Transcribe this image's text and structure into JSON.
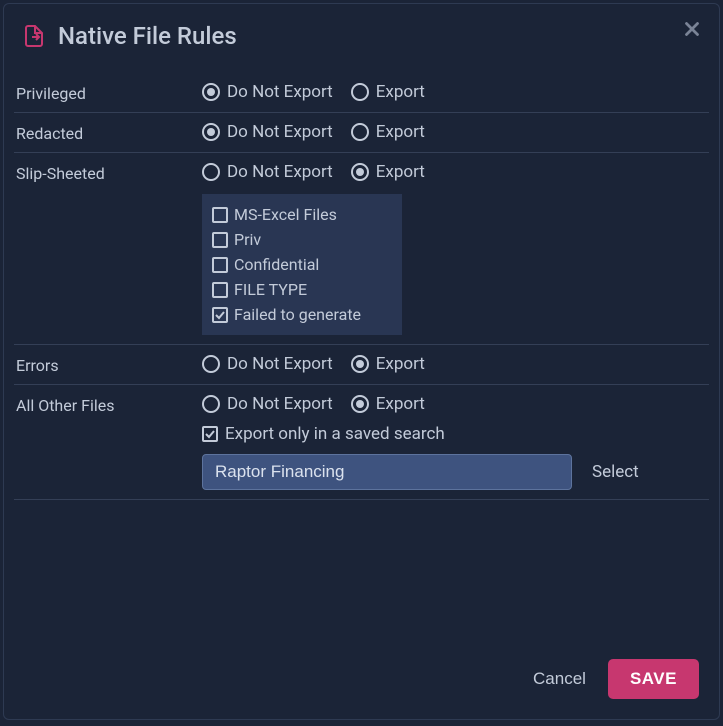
{
  "dialog": {
    "title": "Native File Rules",
    "rules": [
      {
        "label": "Privileged",
        "doNotExport": "Do Not Export",
        "export": "Export",
        "selected": "doNotExport"
      },
      {
        "label": "Redacted",
        "doNotExport": "Do Not Export",
        "export": "Export",
        "selected": "doNotExport"
      },
      {
        "label": "Slip-Sheeted",
        "doNotExport": "Do Not Export",
        "export": "Export",
        "selected": "export",
        "subChecks": [
          {
            "label": "MS-Excel Files",
            "checked": false
          },
          {
            "label": "Priv",
            "checked": false
          },
          {
            "label": "Confidential",
            "checked": false
          },
          {
            "label": "FILE TYPE",
            "checked": false
          },
          {
            "label": "Failed to generate",
            "checked": true
          }
        ]
      },
      {
        "label": "Errors",
        "doNotExport": "Do Not Export",
        "export": "Export",
        "selected": "export"
      },
      {
        "label": "All Other Files",
        "doNotExport": "Do Not Export",
        "export": "Export",
        "selected": "export",
        "savedSearch": {
          "checkLabel": "Export only in a saved search",
          "checked": true,
          "value": "Raptor Financing",
          "selectLabel": "Select"
        }
      }
    ],
    "footer": {
      "cancel": "Cancel",
      "save": "SAVE"
    }
  }
}
